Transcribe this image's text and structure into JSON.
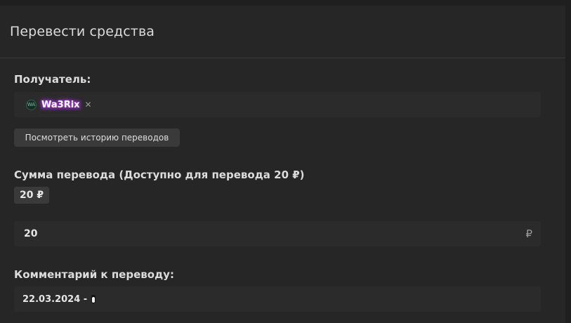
{
  "dialog": {
    "title": "Перевести средства"
  },
  "recipient": {
    "label": "Получатель:",
    "avatar_initials": "WA",
    "username": "Wa3Rix",
    "remove_symbol": "✕"
  },
  "history_button": {
    "label": "Посмотреть историю переводов"
  },
  "amount": {
    "label": "Сумма перевода (Доступно для перевода 20 ₽)",
    "chip_label": "20 ₽",
    "value": "20",
    "currency_symbol": "₽"
  },
  "comment": {
    "label": "Комментарий к переводу:",
    "value": "22.03.2024 - ",
    "icon": "penguin-icon"
  },
  "colors": {
    "background": "#262626",
    "field": "#2b2b2b",
    "button": "#3a3a3a",
    "username_glow": "#d04cff"
  }
}
